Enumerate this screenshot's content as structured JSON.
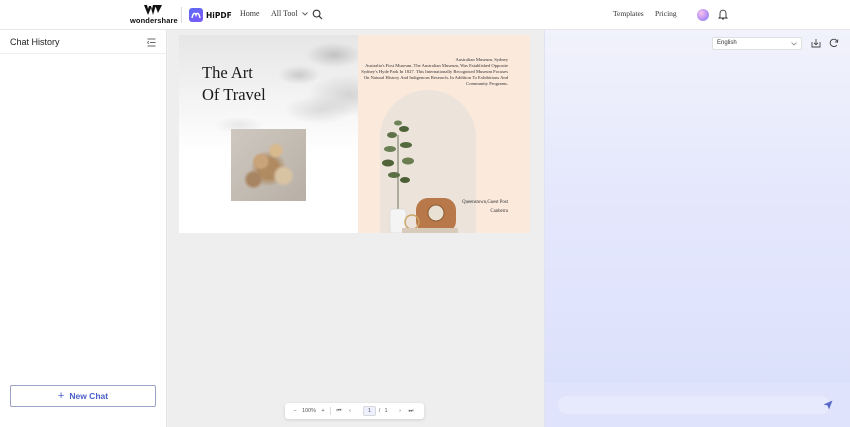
{
  "header": {
    "brand_name": "wondershare",
    "product_name": "HiPDF",
    "nav_home": "Home",
    "nav_all_tool": "All Tool",
    "nav_templates": "Templates",
    "nav_pricing": "Pricing"
  },
  "sidebar": {
    "title": "Chat History",
    "new_chat_label": "New Chat"
  },
  "document": {
    "left_page_title_line1": "The Art",
    "left_page_title_line2": "Of Travel",
    "museum_heading": "Australian Museum, Sydney",
    "museum_body": "Australia's First Museum, The Australian Museum, Was Established Opposite Sydney's Hyde Park In 1827. This Internationally Recognised Museum Focuses On Natural History And Indigenous Research, In Addition To Exhibitions And Community Programs.",
    "location_line1": "Queenstown,Guest Post",
    "location_line2": "Canberra"
  },
  "page_toolbar": {
    "zoom_out": "−",
    "zoom_level": "100%",
    "zoom_in": "+",
    "first_page": "⏮",
    "prev_page": "‹",
    "current_page": "1",
    "page_separator": "/",
    "total_pages": "1",
    "next_page": "›",
    "last_page": "⏭"
  },
  "chat_panel": {
    "language_selected": "English"
  },
  "colors": {
    "accent": "#4a5ec9",
    "chat_bg": "#e5e8fc",
    "page_right_bg": "#fbe9dc"
  }
}
